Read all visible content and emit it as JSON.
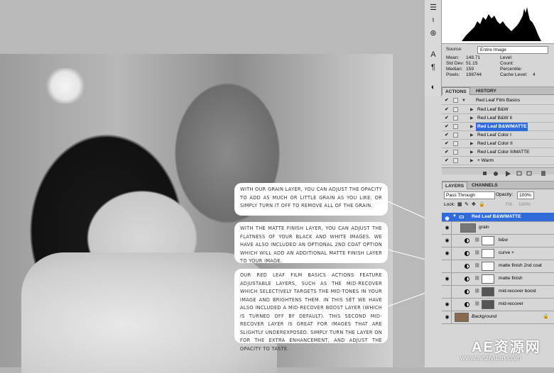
{
  "callouts": {
    "grain": "With our grain layer, you can adjust the opacity to add as much or little grain as you like.  Or simply turn it off to remove all of the grain.",
    "matte": "With the matte finish layer, you can adjust the flatness of your black and white images.  We have also included an optional 2nd coat option which will add an additional matte finish layer to your image.",
    "midrecover": "Our Red Leaf Film Basics actions feature adjustable layers, such as the mid-recover which selectively targets the mid-tones in your image and brightens them.  In this set we have also included a mid-recover boost layer (which is turned off by default).  This second mid-recover layer is great for images that are slightly underexposed. Simply turn the layer on for the extra enhancement, and adjust the opacity to taste."
  },
  "histogram": {
    "source_label": "Source:",
    "source_value": "Entire Image",
    "mean_label": "Mean:",
    "mean_value": "148.71",
    "stddev_label": "Std Dev:",
    "stddev_value": "51.15",
    "median_label": "Median:",
    "median_value": "159",
    "pixels_label": "Pixels:",
    "pixels_value": "198744",
    "level_label": "Level:",
    "count_label": "Count:",
    "percentile_label": "Percentile:",
    "cache_label": "Cache Level:",
    "cache_value": "4"
  },
  "actions": {
    "tabs": [
      "ACTIONS",
      "HISTORY"
    ],
    "set_name": "Red Leaf Film Basics",
    "items": [
      "Red Leaf B&W",
      "Red Leaf B&W II",
      "Red Leaf B&W/MATTE",
      "Red Leaf Color I",
      "Red Leaf Color II",
      "Red Leaf Color II/MATTE",
      "+ Warm"
    ]
  },
  "layers": {
    "tabs": [
      "LAYERS",
      "CHANNELS"
    ],
    "blend_mode": "Pass Through",
    "opacity_label": "Opacity:",
    "opacity_value": "100%",
    "lock_label": "Lock:",
    "fill_label": "Fill:",
    "fill_value": "100%",
    "group_name": "Red Leaf  B&W/MATTE",
    "items": [
      "grain",
      "b&w",
      "curve +",
      "matte finish 2nd coat",
      "matte finish",
      "mid-recover boost",
      "mid-recover"
    ],
    "background": "Background"
  },
  "watermark": {
    "title": "AE资源网",
    "url": "www.aeziyuan.com"
  }
}
